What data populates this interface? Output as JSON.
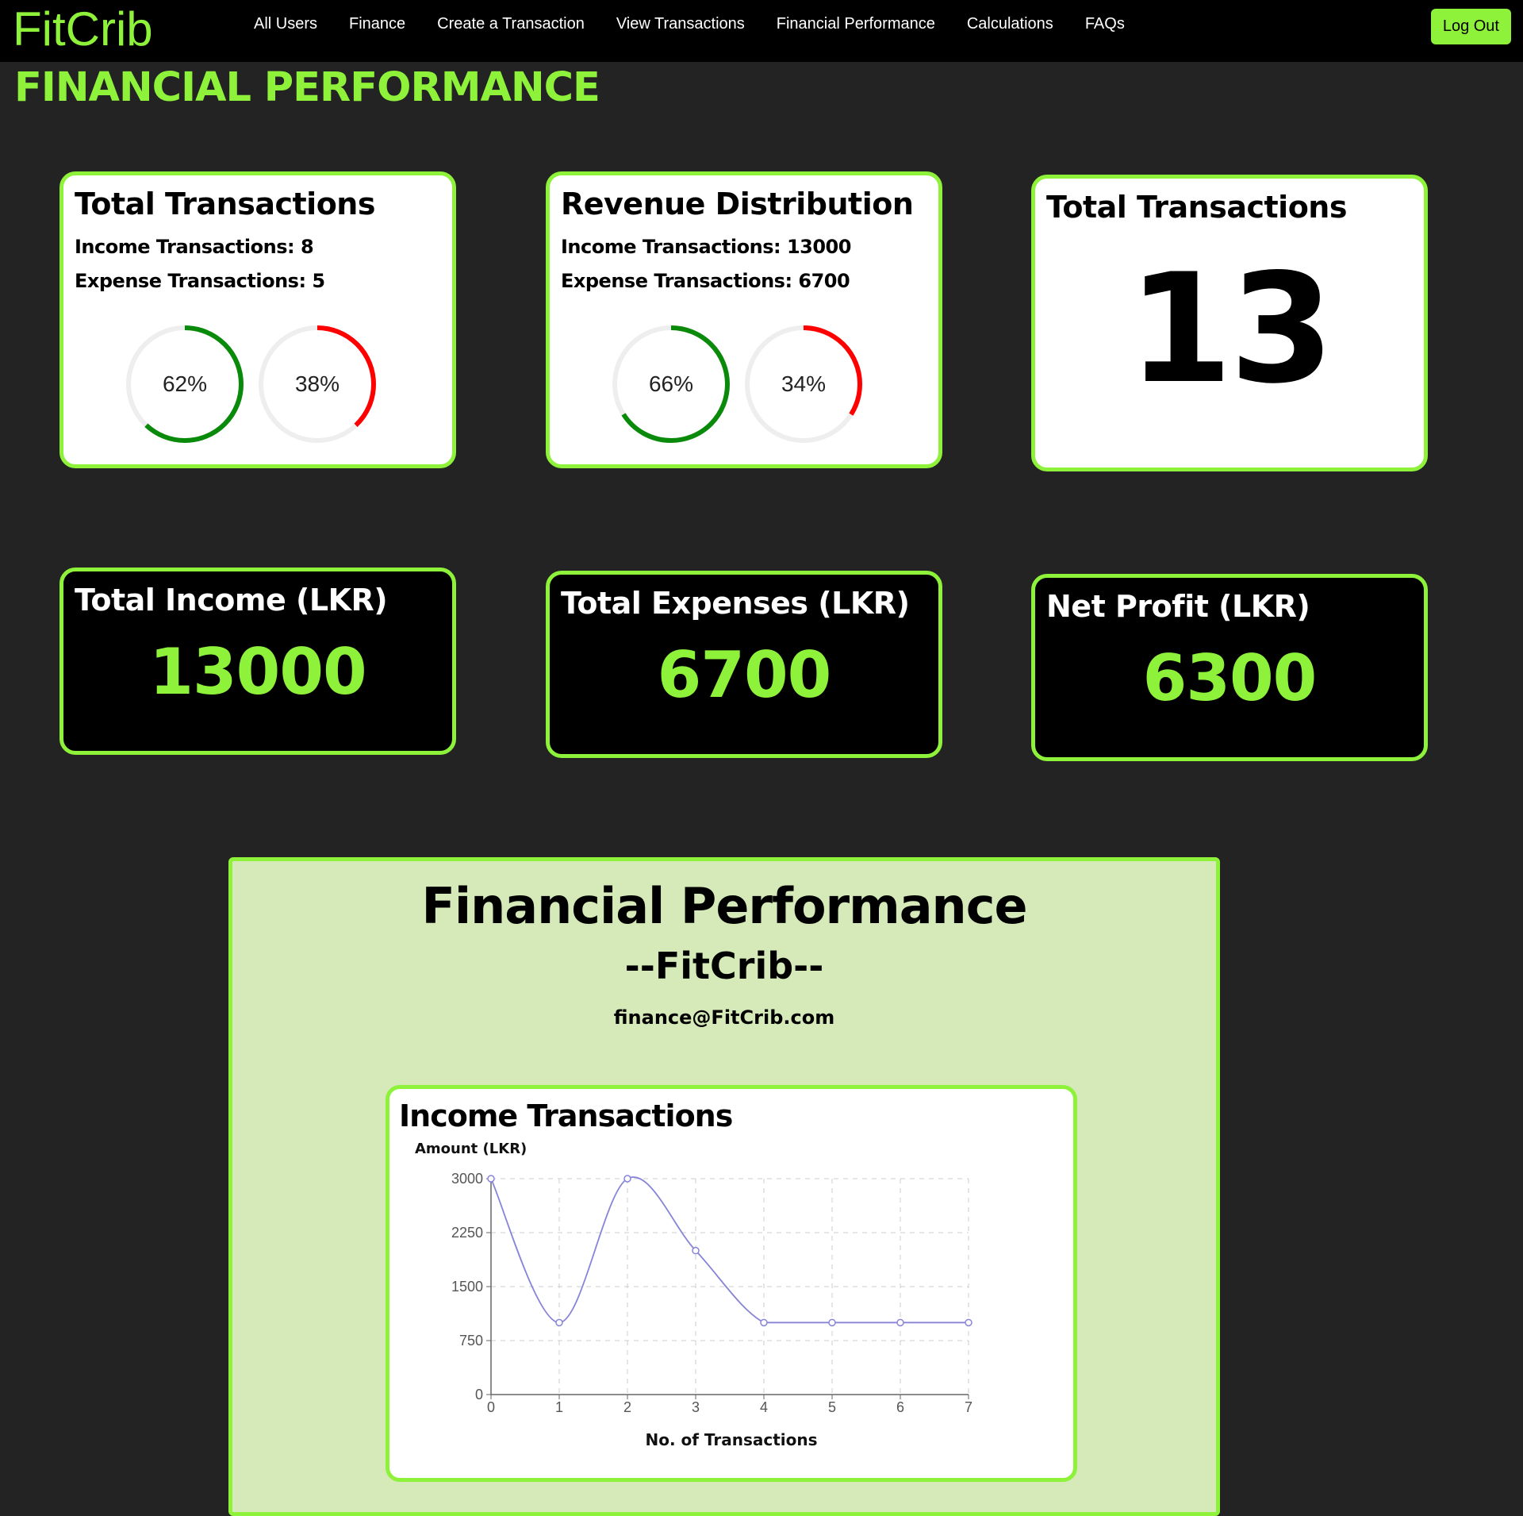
{
  "nav": {
    "brand": "FitCrib",
    "links": [
      "All Users",
      "Finance",
      "Create a Transaction",
      "View Transactions",
      "Financial Performance",
      "Calculations",
      "FAQs"
    ],
    "logout_label": "Log Out"
  },
  "page_title": "FINANCIAL PERFORMANCE",
  "cards": {
    "transactions": {
      "title": "Total Transactions",
      "line1": "Income Transactions: 8",
      "line2": "Expense Transactions: 5",
      "gauge_income": {
        "percent": 62,
        "label": "62%",
        "color": "#0a8a0a"
      },
      "gauge_expense": {
        "percent": 38,
        "label": "38%",
        "color": "#ff0000"
      }
    },
    "revenue": {
      "title": "Revenue Distribution",
      "line1": "Income Transactions: 13000",
      "line2": "Expense Transactions: 6700",
      "gauge_income": {
        "percent": 66,
        "label": "66%",
        "color": "#0a8a0a"
      },
      "gauge_expense": {
        "percent": 34,
        "label": "34%",
        "color": "#ff0000"
      }
    },
    "total": {
      "title": "Total Transactions",
      "value": "13"
    },
    "income": {
      "title": "Total Income (LKR)",
      "value": "13000"
    },
    "expenses": {
      "title": "Total Expenses (LKR)",
      "value": "6700"
    },
    "profit": {
      "title": "Net Profit (LKR)",
      "value": "6300"
    }
  },
  "report": {
    "title": "Financial Performance",
    "subtitle": "--FitCrib--",
    "email": "finance@FitCrib.com",
    "chart_title": "Income Transactions"
  },
  "colors": {
    "accent": "#8ef23a",
    "income": "#0a8a0a",
    "expense": "#ff0000",
    "line": "#8884d8"
  },
  "chart_data": {
    "type": "line",
    "title": "Income Transactions",
    "xlabel": "No. of Transactions",
    "ylabel": "Amount (LKR)",
    "x": [
      0,
      1,
      2,
      3,
      4,
      5,
      6,
      7
    ],
    "series": [
      {
        "values": [
          3000,
          1000,
          3000,
          2000,
          1000,
          1000,
          1000,
          1000
        ]
      }
    ],
    "xlim": [
      0,
      7
    ],
    "ylim": [
      0,
      3000
    ],
    "yticks": [
      0,
      750,
      1500,
      2250,
      3000
    ],
    "xticks": [
      0,
      1,
      2,
      3,
      4,
      5,
      6,
      7
    ],
    "grid": true
  }
}
